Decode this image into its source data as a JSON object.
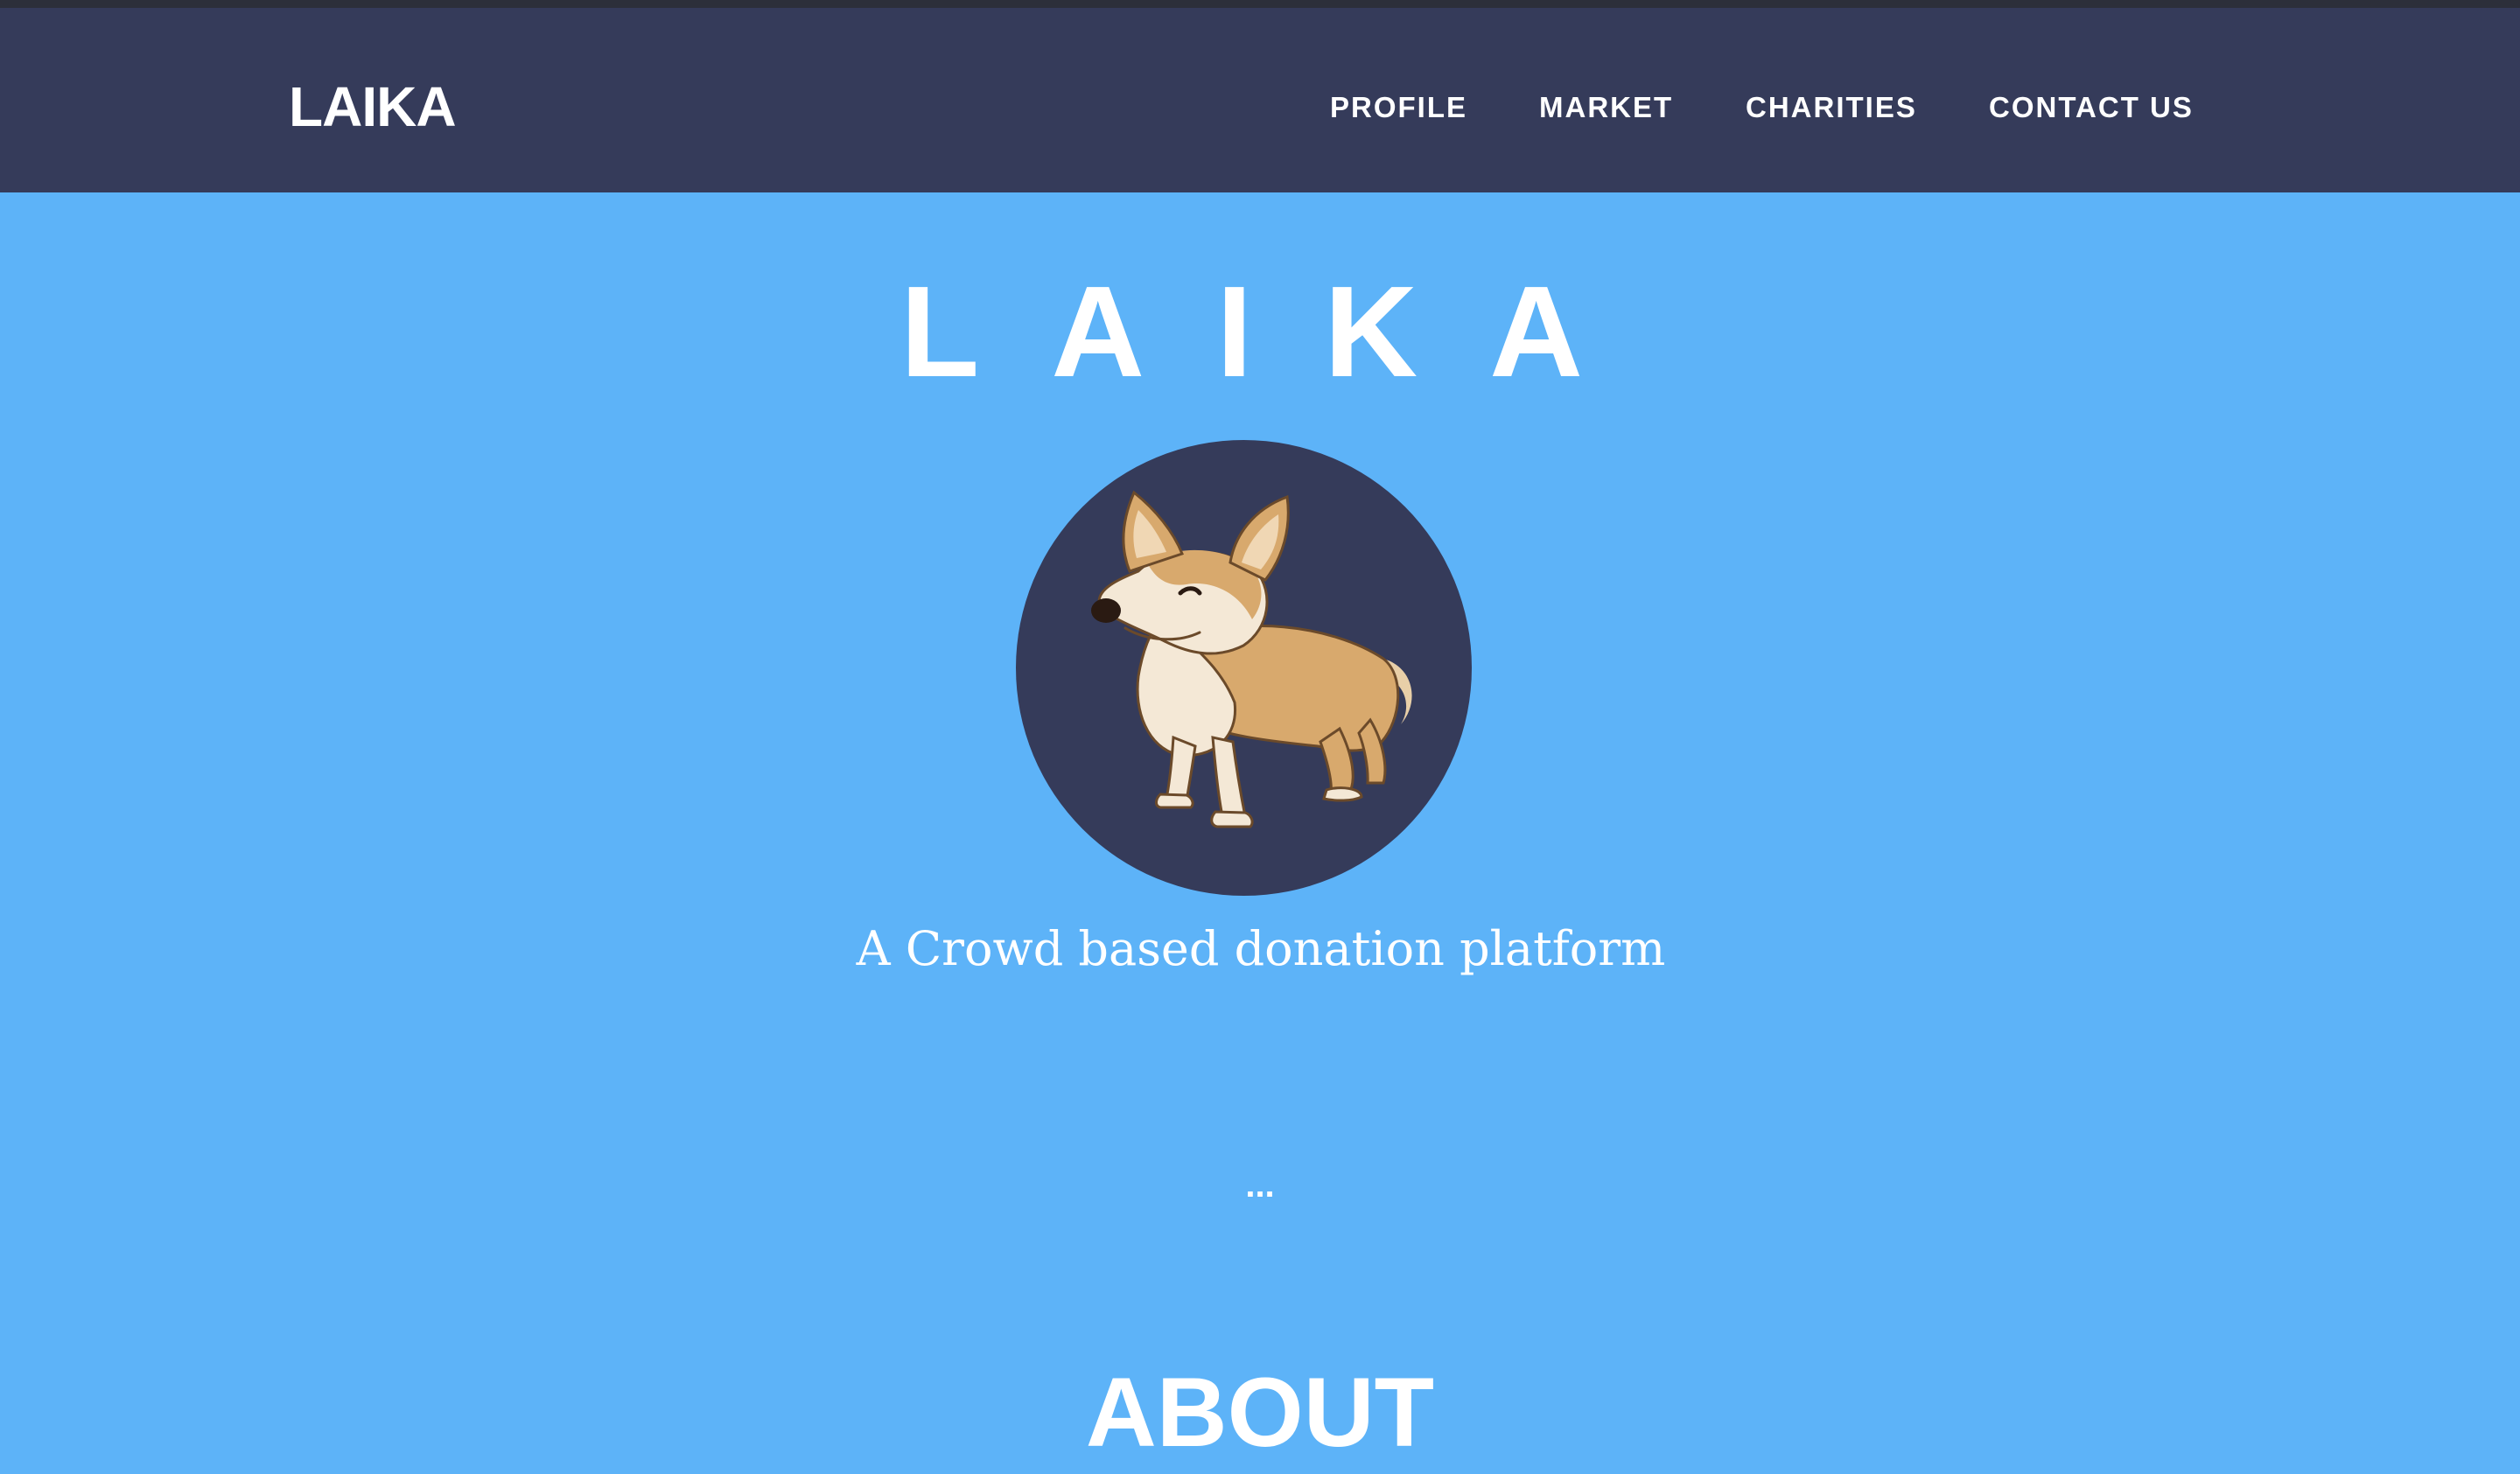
{
  "nav": {
    "brand": "LAIKA",
    "items": [
      {
        "label": "PROFILE"
      },
      {
        "label": "MARKET"
      },
      {
        "label": "CHARITIES"
      },
      {
        "label": "CONTACT US"
      }
    ]
  },
  "hero": {
    "title": "LAIKA",
    "logo_icon": "corgi-dog-icon",
    "tagline": "A Crowd based donation platform",
    "more_label": "..."
  },
  "sections": {
    "about_heading": "ABOUT"
  },
  "colors": {
    "navbar": "#353b5a",
    "background": "#5db3f8",
    "text": "#ffffff"
  }
}
